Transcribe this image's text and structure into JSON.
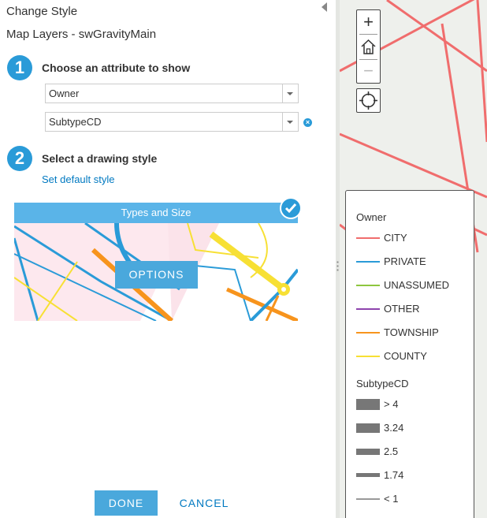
{
  "panel": {
    "title": "Change Style",
    "layer_title": "Map Layers - swGravityMain"
  },
  "step1": {
    "number": "1",
    "label": "Choose an attribute to show",
    "attribute1": "Owner",
    "attribute2": "SubtypeCD"
  },
  "step2": {
    "number": "2",
    "label": "Select a drawing style",
    "default_link": "Set default style",
    "card_title": "Types and Size",
    "options_label": "OPTIONS"
  },
  "footer": {
    "done_label": "DONE",
    "cancel_label": "CANCEL"
  },
  "map_controls": {
    "zoom_in": "+",
    "zoom_out": "−"
  },
  "legend": {
    "owner_title": "Owner",
    "owner_items": [
      {
        "label": "CITY",
        "color": "#f06d6d"
      },
      {
        "label": "PRIVATE",
        "color": "#2a9bd8"
      },
      {
        "label": "UNASSUMED",
        "color": "#8dc63f"
      },
      {
        "label": "OTHER",
        "color": "#8e44ad"
      },
      {
        "label": "TOWNSHIP",
        "color": "#f7941d"
      },
      {
        "label": "COUNTY",
        "color": "#f7e034"
      }
    ],
    "size_title": "SubtypeCD",
    "size_items": [
      {
        "label": "> 4"
      },
      {
        "label": "3.24"
      },
      {
        "label": "2.5"
      },
      {
        "label": "1.74"
      },
      {
        "label": "< 1"
      }
    ]
  },
  "colors": {
    "accent": "#2a9bd8",
    "button": "#4aa8dc",
    "link": "#0079c1",
    "map_road": "#f06d6d"
  }
}
